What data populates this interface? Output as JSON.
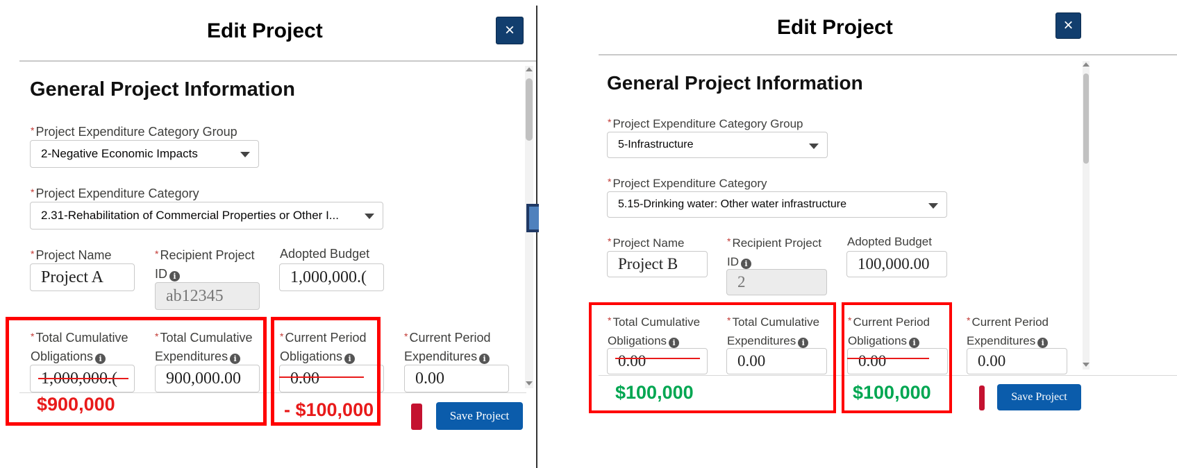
{
  "left": {
    "title": "Edit Project",
    "close_icon": "×",
    "section_title": "General Project Information",
    "category_group": {
      "label": "Project Expenditure Category Group",
      "value": "2-Negative Economic Impacts"
    },
    "category": {
      "label": "Project Expenditure Category",
      "value": "2.31-Rehabilitation of Commercial Properties or Other I..."
    },
    "project_name": {
      "label": "Project Name",
      "value": "Project A"
    },
    "recipient_id": {
      "label_line1": "Recipient Project",
      "label_line2": "ID",
      "value": "ab12345"
    },
    "adopted_budget": {
      "label": "Adopted Budget",
      "value": "1,000,000.("
    },
    "total_obligations": {
      "label_line1": "Total Cumulative",
      "label_line2": "Obligations",
      "value": "1,000,000.("
    },
    "total_expenditures": {
      "label_line1": "Total Cumulative",
      "label_line2": "Expenditures",
      "value": "900,000.00"
    },
    "current_obligations": {
      "label_line1": "Current Period",
      "label_line2": "Obligations",
      "value": "0.00"
    },
    "current_expenditures": {
      "label_line1": "Current Period",
      "label_line2": "Expenditures",
      "value": "0.00"
    },
    "annotation_obligations": "$900,000",
    "annotation_current": "- $100,000",
    "save_label": "Save Project"
  },
  "right": {
    "title": "Edit Project",
    "close_icon": "×",
    "section_title": "General Project Information",
    "category_group": {
      "label": "Project Expenditure Category Group",
      "value": "5-Infrastructure"
    },
    "category": {
      "label": "Project Expenditure Category",
      "value": "5.15-Drinking water: Other water infrastructure"
    },
    "project_name": {
      "label": "Project Name",
      "value": "Project B"
    },
    "recipient_id": {
      "label_line1": "Recipient Project",
      "label_line2": "ID",
      "value": "2"
    },
    "adopted_budget": {
      "label": "Adopted Budget",
      "value": "100,000.00"
    },
    "total_obligations": {
      "label_line1": "Total Cumulative",
      "label_line2": "Obligations",
      "value": "0.00"
    },
    "total_expenditures": {
      "label_line1": "Total Cumulative",
      "label_line2": "Expenditures",
      "value": "0.00"
    },
    "current_obligations": {
      "label_line1": "Current Period",
      "label_line2": "Obligations",
      "value": "0.00"
    },
    "current_expenditures": {
      "label_line1": "Current Period",
      "label_line2": "Expenditures",
      "value": "0.00"
    },
    "annotation_obligations": "$100,000",
    "annotation_current": "$100,000",
    "save_label": "Save Project"
  },
  "colors": {
    "close_button": "#123e6e",
    "save_button": "#0b5cab",
    "annotation_box": "#ff0000",
    "annotation_red": "#e81a1a",
    "annotation_green": "#00a651",
    "arrow_fill": "#4f81bd",
    "arrow_stroke": "#1f3864"
  }
}
